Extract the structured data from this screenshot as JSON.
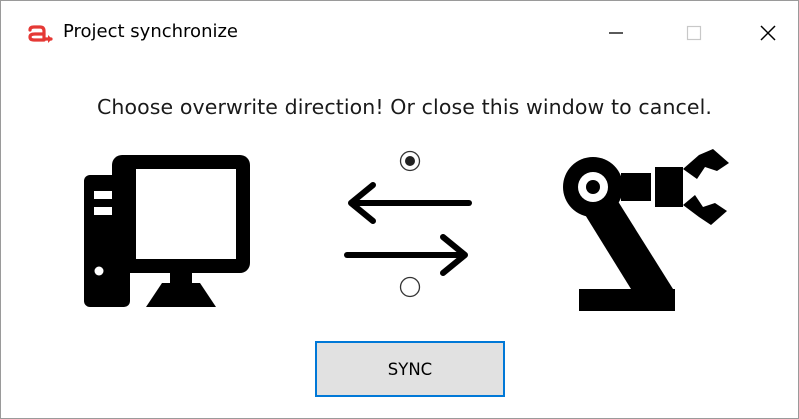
{
  "window": {
    "title": "Project synchronize",
    "logo_icon": "arrow-logo-icon",
    "logo_color": "#e53935",
    "controls": [
      "minimize-icon",
      "maximize-icon",
      "close-icon"
    ]
  },
  "prompt": {
    "text": "Choose overwrite direction! Or close this window to cancel."
  },
  "direction": {
    "source_icon": "computer-icon",
    "target_icon": "robot-arm-icon",
    "options": [
      {
        "icon": "arrow-left-icon",
        "selected": true
      },
      {
        "icon": "arrow-right-icon",
        "selected": false
      }
    ]
  },
  "sync_button": {
    "label": "SYNC",
    "border_color": "#0078d7",
    "background": "#e1e1e1"
  }
}
